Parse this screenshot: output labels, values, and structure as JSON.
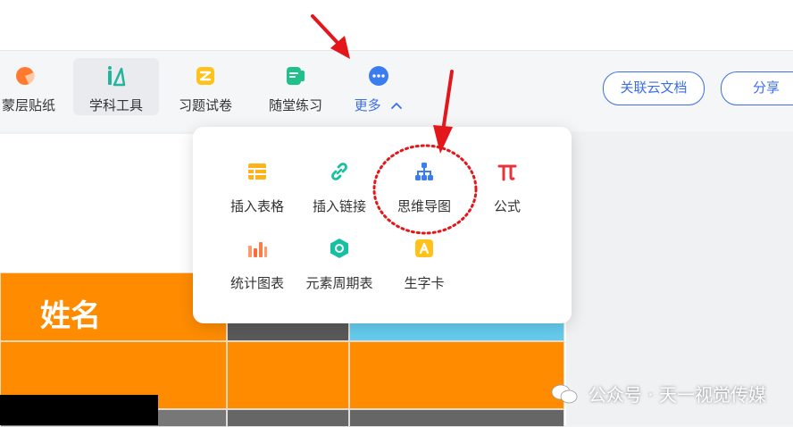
{
  "toolbar": {
    "items": [
      {
        "label": "蒙层贴纸",
        "icon": "sticker-icon"
      },
      {
        "label": "学科工具",
        "icon": "subject-tools-icon"
      },
      {
        "label": "习题试卷",
        "icon": "exercise-paper-icon"
      },
      {
        "label": "随堂练习",
        "icon": "class-practice-icon"
      },
      {
        "label": "更多",
        "icon": "more-icon"
      }
    ],
    "link_cloud_doc": "关联云文档",
    "share": "分享"
  },
  "dropdown": {
    "items": [
      {
        "label": "插入表格",
        "icon": "table-icon"
      },
      {
        "label": "插入链接",
        "icon": "link-icon"
      },
      {
        "label": "思维导图",
        "icon": "mind-map-icon"
      },
      {
        "label": "公式",
        "icon": "formula-pi-icon"
      },
      {
        "label": "统计图表",
        "icon": "bar-chart-icon"
      },
      {
        "label": "元素周期表",
        "icon": "periodic-table-icon"
      },
      {
        "label": "生字卡",
        "icon": "character-card-icon"
      }
    ]
  },
  "table": {
    "header_name": "姓名"
  },
  "watermark": "公众号 · 天一视觉传媒",
  "colors": {
    "accent": "#3b6ee8",
    "table_orange": "#ff8c00",
    "annotation_red": "#e3161b"
  }
}
